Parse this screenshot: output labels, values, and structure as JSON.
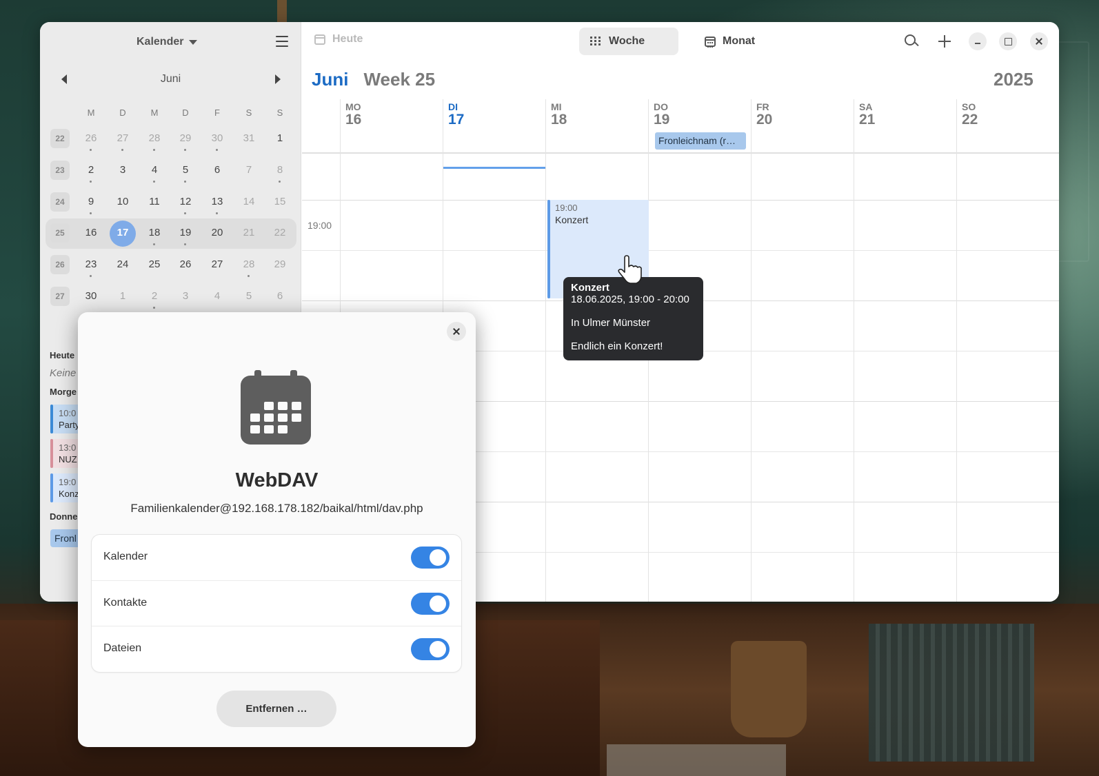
{
  "sidebar": {
    "calendar_dropdown": "Kalender",
    "month_label": "Juni",
    "weekdays": [
      "M",
      "D",
      "M",
      "D",
      "F",
      "S",
      "S"
    ],
    "weeks": [
      {
        "num": "22",
        "days": [
          "26",
          "27",
          "28",
          "29",
          "30",
          "31",
          "1"
        ]
      },
      {
        "num": "23",
        "days": [
          "2",
          "3",
          "4",
          "5",
          "6",
          "7",
          "8"
        ]
      },
      {
        "num": "24",
        "days": [
          "9",
          "10",
          "11",
          "12",
          "13",
          "14",
          "15"
        ]
      },
      {
        "num": "25",
        "days": [
          "16",
          "17",
          "18",
          "19",
          "20",
          "21",
          "22"
        ]
      },
      {
        "num": "26",
        "days": [
          "23",
          "24",
          "25",
          "26",
          "27",
          "28",
          "29"
        ]
      },
      {
        "num": "27",
        "days": [
          "30",
          "1",
          "2",
          "3",
          "4",
          "5",
          "6"
        ]
      }
    ],
    "agenda": {
      "today_heading": "Heute",
      "today_empty": "Keine",
      "tomorrow_heading": "Morge",
      "events": [
        {
          "time": "10:0",
          "title": "Party",
          "color": "#3b8ad6"
        },
        {
          "time": "13:0",
          "title": "NUZ",
          "color": "#d78f9a"
        },
        {
          "time": "19:0",
          "title": "Konz",
          "color": "#5d9ae6"
        }
      ],
      "thursday_heading": "Donne",
      "thursday_event": "Fronl"
    }
  },
  "header": {
    "today_label": "Heute",
    "week_label": "Woche",
    "month_label": "Monat"
  },
  "week_view": {
    "month": "Juni",
    "week": "Week 25",
    "year": "2025",
    "days": [
      {
        "name": "MO",
        "date": "16"
      },
      {
        "name": "DI",
        "date": "17"
      },
      {
        "name": "MI",
        "date": "18"
      },
      {
        "name": "DO",
        "date": "19"
      },
      {
        "name": "FR",
        "date": "20"
      },
      {
        "name": "SA",
        "date": "21"
      },
      {
        "name": "SO",
        "date": "22"
      }
    ],
    "allday_event": "Fronleichnam (r…",
    "time_label": "19:00",
    "event": {
      "time": "19:00",
      "title": "Konzert"
    }
  },
  "tooltip": {
    "title": "Konzert",
    "datetime": "18.06.2025, 19:00 - 20:00",
    "location": "In Ulmer Münster",
    "description": "Endlich ein Konzert!"
  },
  "dialog": {
    "title": "WebDAV",
    "account": "Familienkalender@192.168.178.182/baikal/html/dav.php",
    "options": [
      {
        "label": "Kalender",
        "enabled": true
      },
      {
        "label": "Kontakte",
        "enabled": true
      },
      {
        "label": "Dateien",
        "enabled": true
      }
    ],
    "remove_label": "Entfernen …"
  },
  "colors": {
    "accent": "#3584e4",
    "today_blue": "#1c6bc4",
    "event_fill": "#dce9fb",
    "allday_fill": "#a8c8ec"
  }
}
